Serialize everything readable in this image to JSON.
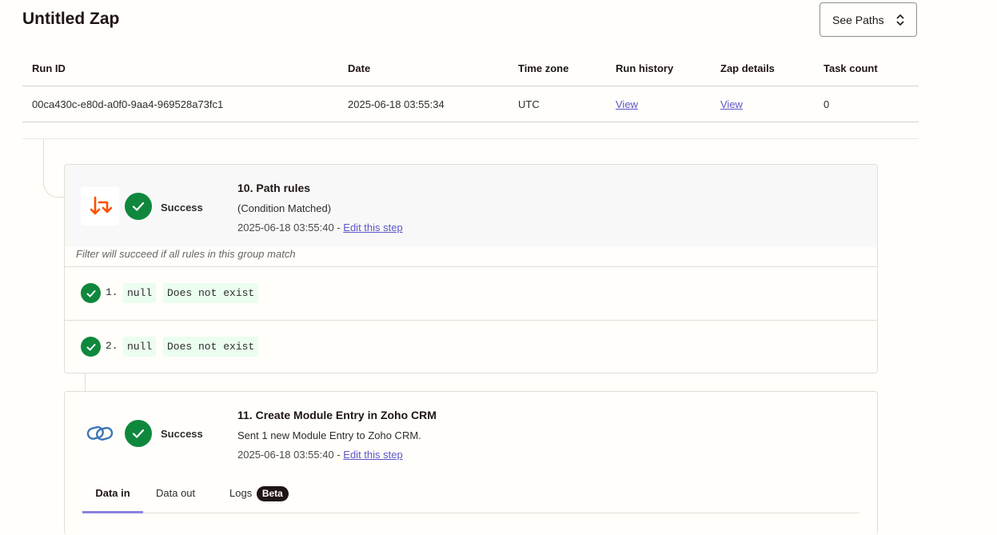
{
  "page": {
    "title": "Untitled Zap"
  },
  "toolbar": {
    "see_paths_label": "See Paths"
  },
  "runs_table": {
    "headers": [
      "Run ID",
      "Date",
      "Time zone",
      "Run history",
      "Zap details",
      "Task count"
    ],
    "row": {
      "run_id": "00ca430c-e80d-a0f0-9aa4-969528a73fc1",
      "date": "2025-06-18 03:55:34",
      "time_zone": "UTC",
      "run_history": "View",
      "zap_details": "View",
      "task_count": "0"
    }
  },
  "steps": [
    {
      "status": "Success",
      "title": "10. Path rules",
      "subtitle": "(Condition Matched)",
      "time": "2025-06-18 03:55:40",
      "time_sep": " - ",
      "edit_link": "Edit this step",
      "filter_note": "Filter will succeed if all rules in this group match",
      "rules": [
        {
          "num": "1.",
          "field": "null",
          "condition": "Does not exist"
        },
        {
          "num": "2.",
          "field": "null",
          "condition": "Does not exist"
        }
      ],
      "icon": "path-arrows-icon",
      "icon_color": "#ff4f00"
    },
    {
      "status": "Success",
      "title": "11. Create Module Entry in Zoho CRM",
      "subtitle": "Sent 1 new Module Entry to Zoho CRM.",
      "time": "2025-06-18 03:55:40",
      "time_sep": " - ",
      "edit_link": "Edit this step",
      "tabs": [
        {
          "label": "Data in",
          "active": true
        },
        {
          "label": "Data out",
          "active": false
        },
        {
          "label": "Logs",
          "badge": "Beta",
          "active": false
        }
      ],
      "icon": "zoho-crm-icon",
      "icon_color": "#3a77b5"
    }
  ],
  "colors": {
    "success": "#0f883d",
    "link": "#5b55c7",
    "tab_active": "#8b82e0"
  }
}
